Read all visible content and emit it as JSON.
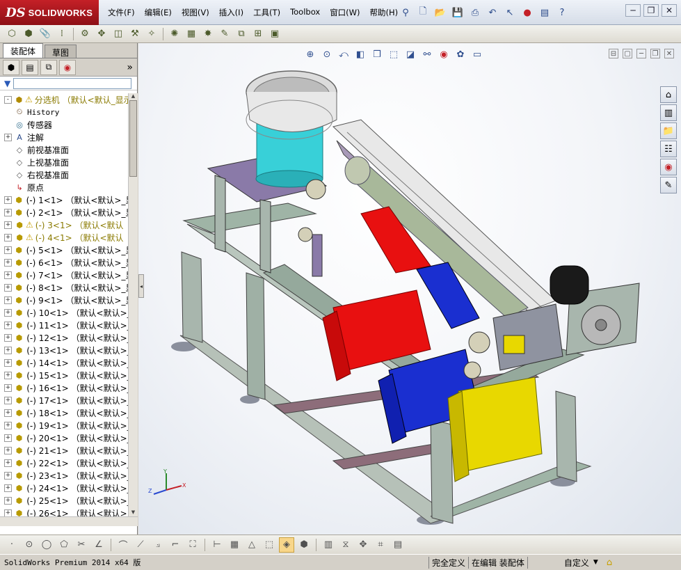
{
  "app": {
    "logo_ds": "DS",
    "logo_name": "SOLIDWORKS"
  },
  "menu": [
    "文件(F)",
    "编辑(E)",
    "视图(V)",
    "插入(I)",
    "工具(T)",
    "Toolbox",
    "窗口(W)",
    "帮助(H)"
  ],
  "left_panel": {
    "tabs": [
      "装配体",
      "草图"
    ],
    "more": "»"
  },
  "tree": [
    {
      "label": "分选机 （默认<默认_显示",
      "type": "assembly",
      "warn": true,
      "expander": "-"
    },
    {
      "label": "History",
      "type": "history",
      "mono": true
    },
    {
      "label": "传感器",
      "type": "sensor"
    },
    {
      "label": "注解",
      "type": "annotation",
      "expander": "+"
    },
    {
      "label": "前视基准面",
      "type": "plane"
    },
    {
      "label": "上视基准面",
      "type": "plane"
    },
    {
      "label": "右视基准面",
      "type": "plane"
    },
    {
      "label": "原点",
      "type": "origin"
    },
    {
      "label": "(-) 1<1> （默认<默认>_显",
      "type": "part",
      "expander": "+"
    },
    {
      "label": "(-) 2<1> （默认<默认>_显",
      "type": "part",
      "expander": "+"
    },
    {
      "label": "(-) 3<1> （默认<默认",
      "type": "part",
      "expander": "+",
      "warn": true
    },
    {
      "label": "(-) 4<1> （默认<默认",
      "type": "part",
      "expander": "+",
      "warn": true
    },
    {
      "label": "(-) 5<1> （默认<默认>_显",
      "type": "part",
      "expander": "+"
    },
    {
      "label": "(-) 6<1> （默认<默认>_显",
      "type": "part",
      "expander": "+"
    },
    {
      "label": "(-) 7<1> （默认<默认>_显",
      "type": "part",
      "expander": "+"
    },
    {
      "label": "(-) 8<1> （默认<默认>_显",
      "type": "part",
      "expander": "+"
    },
    {
      "label": "(-) 9<1> （默认<默认>_显",
      "type": "part",
      "expander": "+"
    },
    {
      "label": "(-) 10<1> （默认<默认>_",
      "type": "part",
      "expander": "+"
    },
    {
      "label": "(-) 11<1> （默认<默认>_",
      "type": "part",
      "expander": "+"
    },
    {
      "label": "(-) 12<1> （默认<默认>_",
      "type": "part",
      "expander": "+"
    },
    {
      "label": "(-) 13<1> （默认<默认>_",
      "type": "part",
      "expander": "+"
    },
    {
      "label": "(-) 14<1> （默认<默认>_",
      "type": "part",
      "expander": "+"
    },
    {
      "label": "(-) 15<1> （默认<默认>_",
      "type": "part",
      "expander": "+"
    },
    {
      "label": "(-) 16<1> （默认<默认>_",
      "type": "part",
      "expander": "+"
    },
    {
      "label": "(-) 17<1> （默认<默认>_",
      "type": "part",
      "expander": "+"
    },
    {
      "label": "(-) 18<1> （默认<默认>_",
      "type": "part",
      "expander": "+"
    },
    {
      "label": "(-) 19<1> （默认<默认>_",
      "type": "part",
      "expander": "+"
    },
    {
      "label": "(-) 20<1> （默认<默认>_",
      "type": "part",
      "expander": "+"
    },
    {
      "label": "(-) 21<1> （默认<默认>_",
      "type": "part",
      "expander": "+"
    },
    {
      "label": "(-) 22<1> （默认<默认>_",
      "type": "part",
      "expander": "+"
    },
    {
      "label": "(-) 23<1> （默认<默认>_",
      "type": "part",
      "expander": "+"
    },
    {
      "label": "(-) 24<1> （默认<默认>_",
      "type": "part",
      "expander": "+"
    },
    {
      "label": "(-) 25<1> （默认<默认>_",
      "type": "part",
      "expander": "+"
    },
    {
      "label": "(-) 26<1> （默认<默认>_",
      "type": "part",
      "expander": "+"
    }
  ],
  "triad": {
    "x": "X",
    "y": "Y",
    "z": "Z"
  },
  "status": {
    "product": "SolidWorks Premium 2014 x64 版",
    "definition": "完全定义",
    "mode": "在编辑 装配体",
    "units": "自定义",
    "units_arrow": "▼"
  },
  "colors": {
    "accent": "#c42027",
    "frame": "#9fb4a6",
    "bin_red": "#e81010",
    "bin_blue": "#1a2fd0",
    "bin_yellow": "#e8d800",
    "bowl": "#38d0d8"
  }
}
